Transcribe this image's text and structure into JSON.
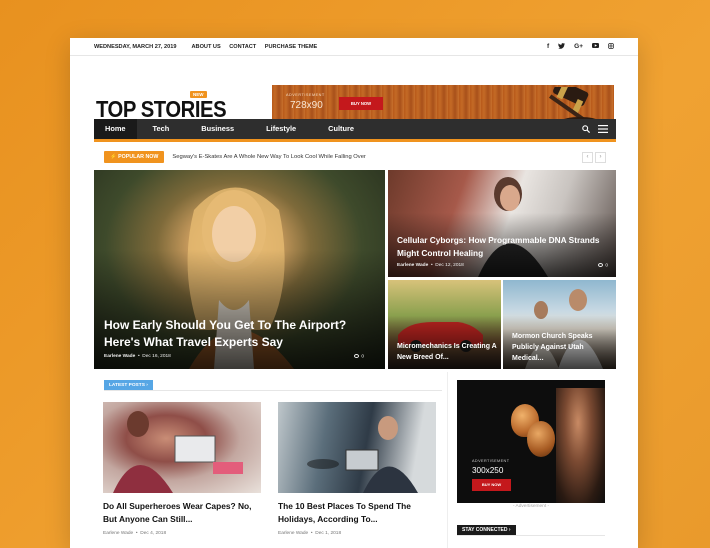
{
  "topbar": {
    "date": "WEDNESDAY, MARCH 27, 2019",
    "links": [
      "ABOUT US",
      "CONTACT",
      "PURCHASE THEME"
    ],
    "social_icons": [
      "facebook-icon",
      "twitter-icon",
      "google-plus-icon",
      "youtube-icon",
      "instagram-icon"
    ]
  },
  "header": {
    "logo_text": "TOP STORIES",
    "logo_badge": "NEW",
    "ad": {
      "label": "ADVERTISEMENT",
      "size": "728x90",
      "button": "BUY NOW"
    }
  },
  "nav": {
    "items": [
      "Home",
      "Tech",
      "Business",
      "Lifestyle",
      "Culture"
    ],
    "active": "Home",
    "icons": [
      "search-icon",
      "menu-icon"
    ]
  },
  "ticker": {
    "badge": "POPULAR NOW",
    "text": "Segway's E-Skates Are A Whole New Way To Look Cool While Falling Over",
    "prev": "‹",
    "next": "›"
  },
  "hero": {
    "main": {
      "title": "How Early Should You Get To The Airport? Here's What Travel Experts Say",
      "author": "Earlene Wade",
      "date": "Dec 16, 2018",
      "comments": "0"
    },
    "top_right": {
      "title": "Cellular Cyborgs: How Programmable DNA Strands Might Control Healing",
      "author": "Earlene Wade",
      "date": "Dec 12, 2018",
      "comments": "0"
    },
    "bottom_left": {
      "title": "Micromechanics Is Creating A New Breed Of..."
    },
    "bottom_right": {
      "title": "Mormon Church Speaks Publicly Against Utah Medical..."
    }
  },
  "latest": {
    "badge": "LATEST POSTS",
    "posts": [
      {
        "title": "Do All Superheroes Wear Capes? No, But Anyone Can Still...",
        "author": "Earlene Wade",
        "date": "Dec 4, 2018"
      },
      {
        "title": "The 10 Best Places To Spend The Holidays, According To...",
        "author": "Earlene Wade",
        "date": "Dec 1, 2018"
      }
    ]
  },
  "sidebar": {
    "ad": {
      "label": "ADVERTISEMENT",
      "size": "300x250",
      "button": "BUY NOW"
    },
    "caption": "- Advertisement -",
    "stay_connected": "STAY CONNECTED"
  },
  "colors": {
    "accent": "#f0931e",
    "nav_bg": "#2e2e2e",
    "latest_badge": "#56a6e5",
    "ad_button": "#c4181c"
  }
}
